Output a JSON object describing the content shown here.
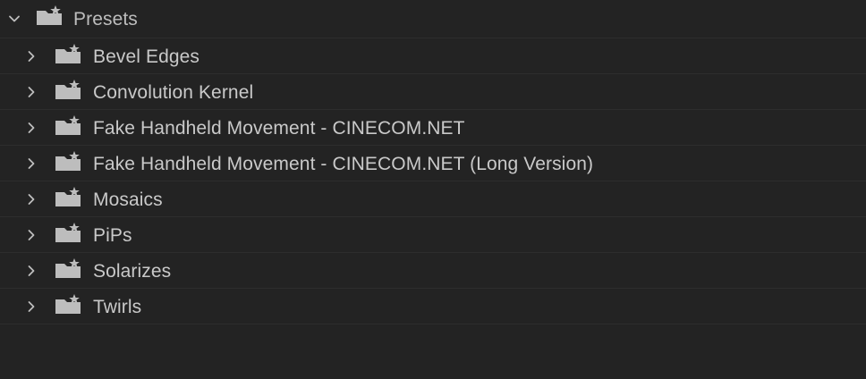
{
  "tree": {
    "root": {
      "label": "Presets",
      "expanded": true,
      "icon": "preset-folder-icon"
    },
    "items": [
      {
        "label": "Bevel Edges",
        "icon": "preset-folder-icon"
      },
      {
        "label": "Convolution Kernel",
        "icon": "preset-folder-icon"
      },
      {
        "label": "Fake Handheld Movement - CINECOM.NET",
        "icon": "preset-folder-icon"
      },
      {
        "label": "Fake Handheld Movement - CINECOM.NET (Long Version)",
        "icon": "preset-folder-icon"
      },
      {
        "label": "Mosaics",
        "icon": "preset-folder-icon"
      },
      {
        "label": "PiPs",
        "icon": "preset-folder-icon"
      },
      {
        "label": "Solarizes",
        "icon": "preset-folder-icon"
      },
      {
        "label": "Twirls",
        "icon": "preset-folder-icon"
      }
    ]
  },
  "colors": {
    "background": "#232323",
    "text": "#c9c9c9",
    "icon": "#bdbdbd",
    "divider": "#2d2d2d"
  }
}
